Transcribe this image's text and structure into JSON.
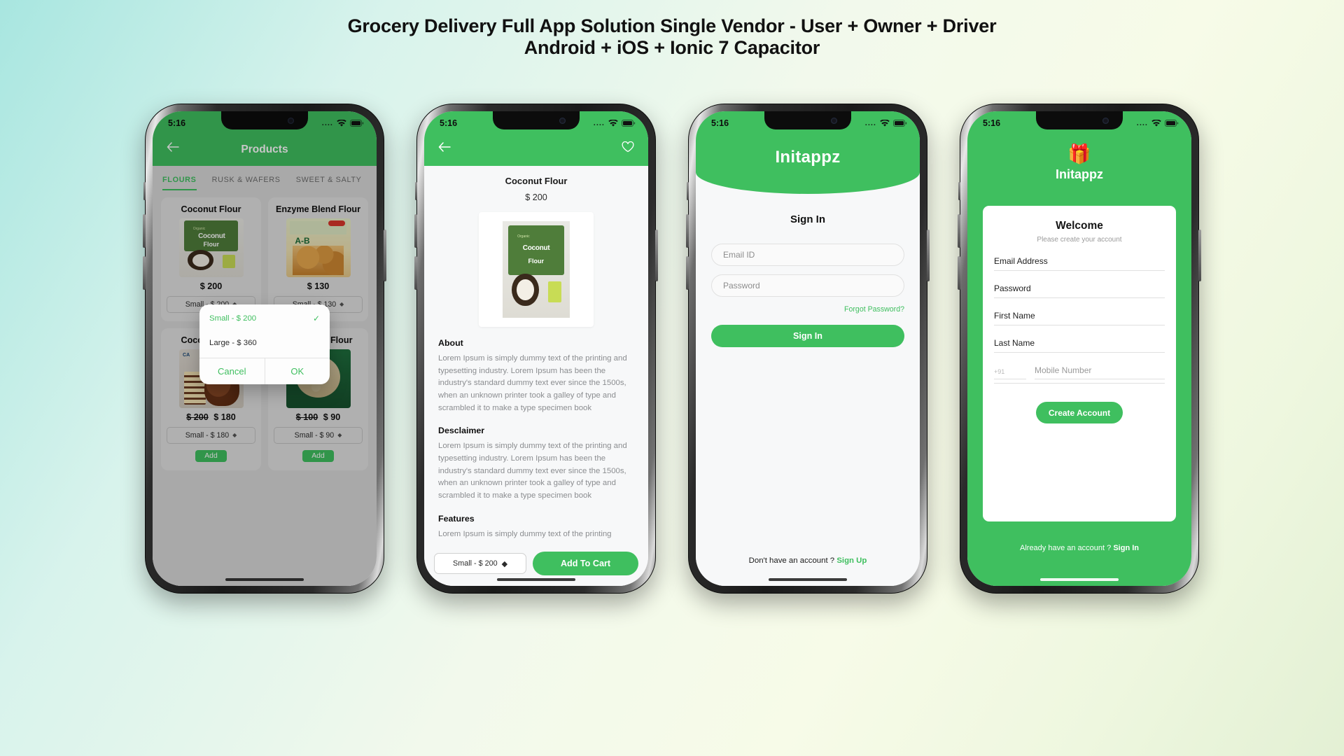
{
  "banner": {
    "line1": "Grocery Delivery Full App Solution Single Vendor - User + Owner + Driver",
    "line2": "Android + iOS + Ionic 7 Capacitor"
  },
  "colors": {
    "brand_green": "#3fbf5f",
    "screen_bg": "#f7f8f9",
    "products_bg": "#d9d9d9"
  },
  "status_bar": {
    "time": "5:16",
    "signal_dots": "....",
    "wifi": "wifi-icon",
    "battery": "battery-icon"
  },
  "screen1": {
    "appbar": {
      "back": "back-arrow-icon",
      "title": "Products"
    },
    "tabs": [
      {
        "label": "FLOURS",
        "active": true
      },
      {
        "label": "RUSK & WAFERS",
        "active": false
      },
      {
        "label": "SWEET & SALTY",
        "active": false
      }
    ],
    "products": [
      {
        "name": "Coconut Flour",
        "price": "$ 200",
        "old_price": "",
        "variant": "Small  -   $ 200",
        "has_add": false,
        "art": "pk-coconut"
      },
      {
        "name": "Enzyme Blend Flour",
        "price": "$ 130",
        "old_price": "",
        "variant": "Small  -   $ 130",
        "has_add": false,
        "art": "pk-enzyme"
      },
      {
        "name": "Coconut Flour",
        "price": "$ 180",
        "old_price": "$ 200",
        "variant": "Small  -   $ 180",
        "has_add": true,
        "add_label": "Add",
        "art": "pk-cake"
      },
      {
        "name": "Multi Seed Flour",
        "price": "$ 90",
        "old_price": "$ 100",
        "variant": "Small  -   $ 90",
        "has_add": true,
        "add_label": "Add",
        "art": "pk-seed"
      }
    ],
    "alert": {
      "options": [
        {
          "label": "Small  -   $ 200",
          "selected": true,
          "check": "check-icon"
        },
        {
          "label": "Large  -   $ 360",
          "selected": false,
          "check": ""
        }
      ],
      "cancel": "Cancel",
      "ok": "OK"
    }
  },
  "screen2": {
    "appbar": {
      "back": "back-arrow-icon",
      "favorite": "heart-icon"
    },
    "product_name": "Coconut Flour",
    "product_price": "$ 200",
    "sections": [
      {
        "heading": "About",
        "text": "Lorem Ipsum is simply dummy text of the printing and typesetting industry. Lorem Ipsum has been the industry's standard dummy text ever since the 1500s, when an unknown printer took a galley of type and scrambled it to make a type specimen book"
      },
      {
        "heading": "Desclaimer",
        "text": "Lorem Ipsum is simply dummy text of the printing and typesetting industry. Lorem Ipsum has been the industry's standard dummy text ever since the 1500s, when an unknown printer took a galley of type and scrambled it to make a type specimen book"
      },
      {
        "heading": "Features",
        "text": "Lorem Ipsum is simply dummy text of the printing"
      }
    ],
    "bottom": {
      "variant": "Small  -   $ 200",
      "cart_label": "Add To Cart"
    }
  },
  "screen3": {
    "brand": "Initappz",
    "heading": "Sign In",
    "email_placeholder": "Email ID",
    "password_placeholder": "Password",
    "forgot": "Forgot Password?",
    "signin_label": "Sign In",
    "footer_text": "Don't have an account ?",
    "footer_link": "Sign Up"
  },
  "screen4": {
    "logo_icon": "gift-box-icon",
    "brand": "Initappz",
    "heading": "Welcome",
    "subheading": "Please create your account",
    "fields": [
      {
        "label": "Email Address"
      },
      {
        "label": "Password"
      },
      {
        "label": "First Name"
      },
      {
        "label": "Last Name"
      }
    ],
    "country_code": "+91",
    "mobile_placeholder": "Mobile Number",
    "create_label": "Create Account",
    "footer_text": "Already have an account ?",
    "footer_link": "Sign In"
  }
}
